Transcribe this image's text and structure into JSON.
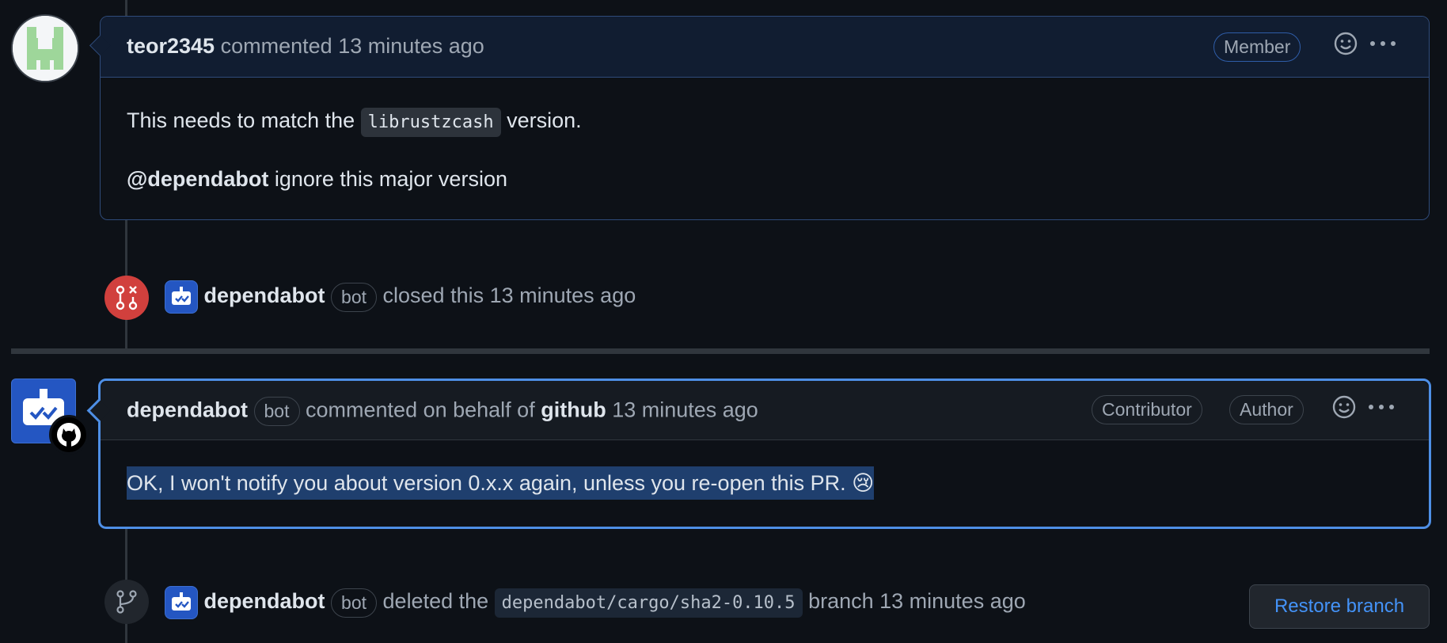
{
  "comment1": {
    "author": "teor2345",
    "action": "commented",
    "time": "13 minutes ago",
    "role_badge": "Member",
    "body_line1_prefix": "This needs to match the",
    "body_line1_code": "librustzcash",
    "body_line1_suffix": "version.",
    "body_line2_mention": "@dependabot",
    "body_line2_rest": "ignore this major version",
    "avatar_icon": "identicon-green"
  },
  "event_closed": {
    "icon": "pull-request-closed-icon",
    "actor": "dependabot",
    "badge": "bot",
    "text": "closed this 13 minutes ago"
  },
  "comment2": {
    "author": "dependabot",
    "badge": "bot",
    "action": "commented on behalf of",
    "behalf": "github",
    "time": "13 minutes ago",
    "badge_contributor": "Contributor",
    "badge_author": "Author",
    "body": "OK, I won't notify you about version 0.x.x again, unless you re-open this PR.",
    "emoji": "😢"
  },
  "event_deleted": {
    "icon": "git-branch-icon",
    "actor": "dependabot",
    "badge": "bot",
    "text_prefix": "deleted the",
    "branch": "dependabot/cargo/sha2-0.10.5",
    "text_suffix": "branch 13 minutes ago",
    "button": "Restore branch"
  },
  "colors": {
    "background": "#0d1117",
    "accent": "#4493f8",
    "closed_red": "#d1403d",
    "bot_blue": "#2456c2"
  }
}
